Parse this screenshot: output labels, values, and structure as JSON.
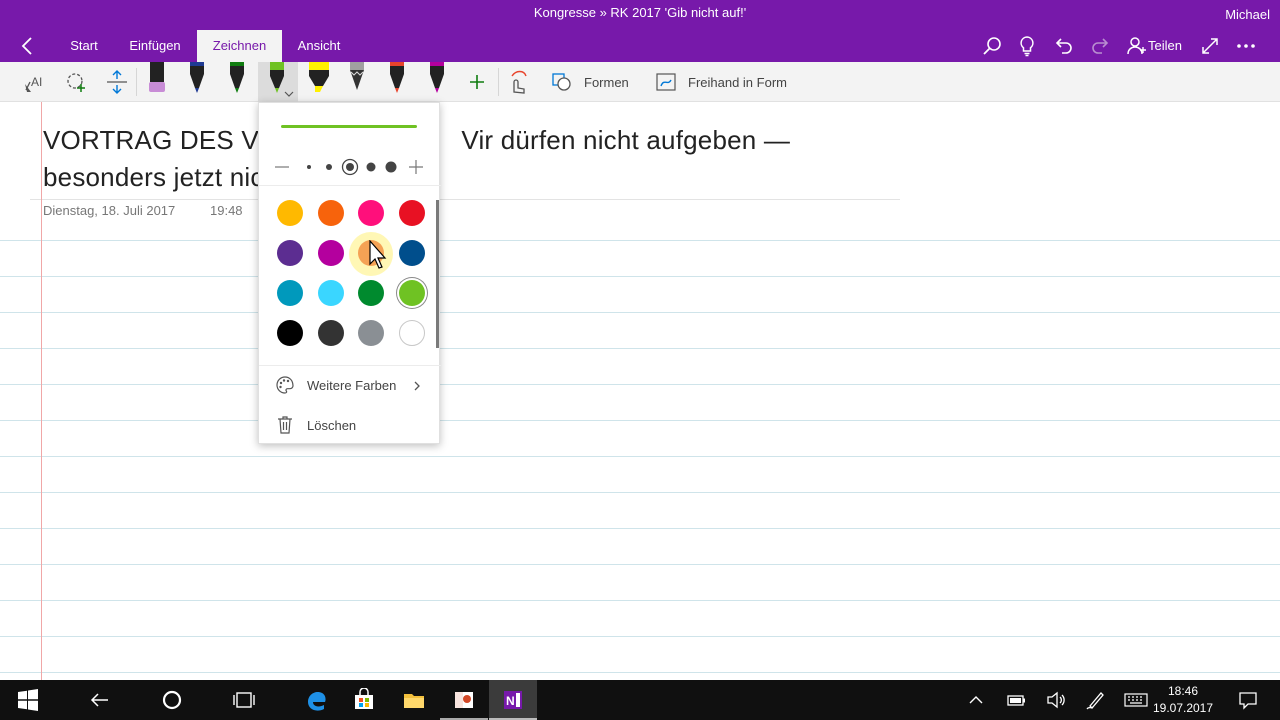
{
  "titlebar": {
    "document_title": "Kongresse » RK 2017 'Gib nicht auf!'",
    "user": "Michael",
    "tabs": [
      {
        "label": "Start"
      },
      {
        "label": "Einfügen"
      },
      {
        "label": "Zeichnen"
      },
      {
        "label": "Ansicht"
      }
    ],
    "active_tab": "Zeichnen",
    "share_label": "Teilen",
    "accent_color": "#7719aa"
  },
  "ribbon": {
    "shapes_label": "Formen",
    "ink_to_shape_label": "Freihand in Form",
    "pens": [
      {
        "kind": "marker",
        "color": "#c88cd6"
      },
      {
        "kind": "pen",
        "color": "#1f3a93"
      },
      {
        "kind": "pen",
        "color": "#107c10"
      },
      {
        "kind": "pen",
        "color": "#6fc223",
        "selected": true
      },
      {
        "kind": "highlighter",
        "color": "#fff100"
      },
      {
        "kind": "pencil",
        "color": "#a0a0a0"
      },
      {
        "kind": "pen",
        "color": "#e8442c"
      },
      {
        "kind": "pen",
        "color": "#b4009e"
      }
    ],
    "add_pen_icon": "plus-icon"
  },
  "page": {
    "title_line1": "VORTRAG DES VO",
    "title_line1_right": "Vir dürfen nicht aufgeben —",
    "title_line2": "besonders jetzt nic",
    "date": "Dienstag, 18. Juli 2017",
    "time": "19:48"
  },
  "flyout": {
    "stroke_color": "#6fc223",
    "size_selected_index": 2,
    "colors": [
      "#ffb900",
      "#f7630c",
      "#ff0f7b",
      "#e81123",
      "#5c2d91",
      "#b4009e",
      "#e8442c",
      "#004e8c",
      "#0099bc",
      "#3ad6ff",
      "#008a2e",
      "#6fc223",
      "#000000",
      "#333333",
      "#8a8f94",
      "#ffffff"
    ],
    "selected_color_index": 11,
    "more_colors_label": "Weitere Farben",
    "delete_label": "Löschen"
  },
  "taskbar": {
    "time": "18:46",
    "date": "19.07.2017"
  }
}
